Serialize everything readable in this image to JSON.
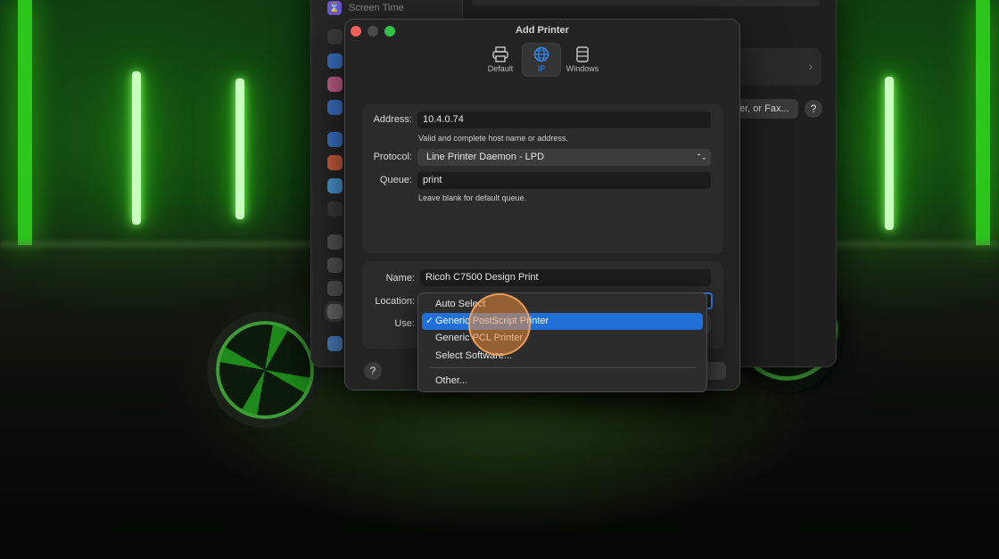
{
  "background_window": {
    "sidebar_top_item": "Screen Time",
    "share_button_label": "er, or Fax...",
    "help_label": "?"
  },
  "dialog": {
    "title": "Add Printer",
    "toolbar": [
      {
        "label": "Default",
        "icon": "printer-icon",
        "selected": false
      },
      {
        "label": "IP",
        "icon": "globe-icon",
        "selected": true
      },
      {
        "label": "Windows",
        "icon": "windows-printer-icon",
        "selected": false
      }
    ],
    "fields": {
      "address_label": "Address:",
      "address_value": "10.4.0.74",
      "address_hint": "Valid and complete host name or address.",
      "protocol_label": "Protocol:",
      "protocol_value": "Line Printer Daemon - LPD",
      "queue_label": "Queue:",
      "queue_value": "print",
      "queue_hint": "Leave blank for default queue.",
      "name_label": "Name:",
      "name_value": "Ricoh C7500 Design Print",
      "location_label": "Location:",
      "use_label": "Use:"
    },
    "help_label": "?"
  },
  "use_menu": {
    "items": [
      {
        "label": "Auto Select",
        "selected": false
      },
      {
        "label": "Generic PostScript Printer",
        "selected": true
      },
      {
        "label": "Generic PCL Printer",
        "selected": false
      },
      {
        "label": "Select Software...",
        "selected": false
      },
      {
        "label": "Other...",
        "selected": false
      }
    ],
    "check_glyph": "✓"
  },
  "colors": {
    "accent": "#1f6fd6",
    "selected_tab": "#2f8bf5",
    "close": "#ed5f57",
    "zoom": "#32c148",
    "neon": "#3fe020"
  }
}
